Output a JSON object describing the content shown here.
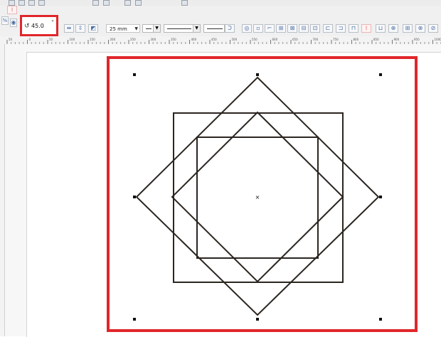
{
  "app": {
    "accent_color": "#e0262a",
    "shape_stroke": "#2b2520"
  },
  "property_bar": {
    "rotation_icon": "rotate-icon",
    "rotation_value": "45.0",
    "rotation_unit": "°",
    "outline_width": "25 mm"
  },
  "ruler": {
    "ticks": [
      "50",
      "0",
      "50",
      "100",
      "150",
      "200",
      "250",
      "300",
      "350",
      "400",
      "450",
      "500",
      "550",
      "600",
      "650",
      "700",
      "750",
      "800",
      "850",
      "900",
      "950",
      "1000"
    ]
  },
  "canvas": {
    "shapes": [
      "outer-square",
      "rotated-square-large",
      "inner-square",
      "rotated-square-small"
    ],
    "selection_handles": 8,
    "center_marker": "×"
  }
}
